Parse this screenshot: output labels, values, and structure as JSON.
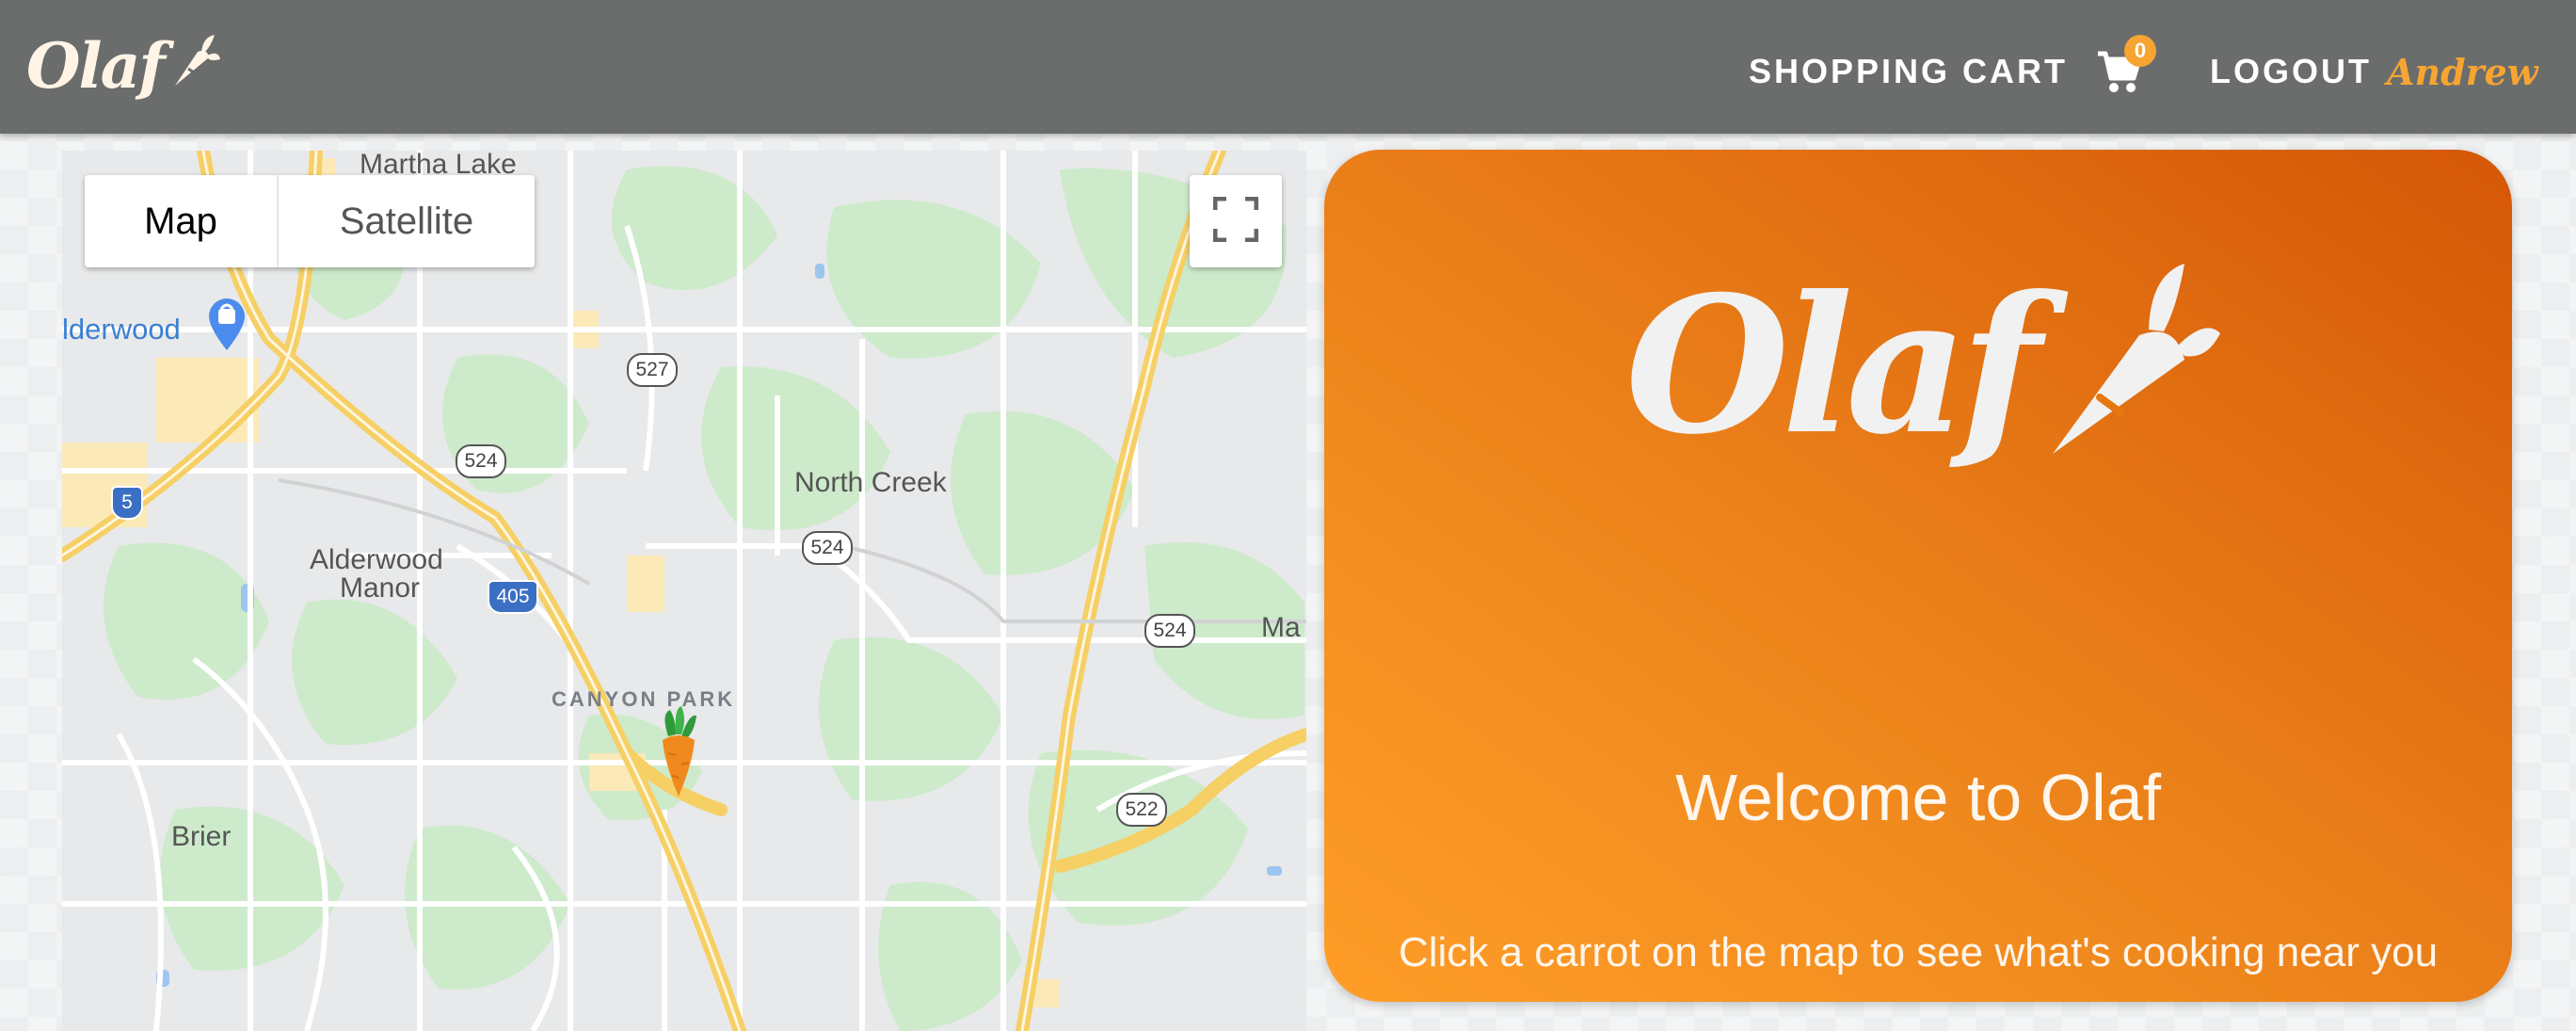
{
  "navbar": {
    "brand": "Olaf",
    "cart_label": "SHOPPING CART",
    "cart_count": "0",
    "logout_label": "LOGOUT",
    "user_name": "Andrew"
  },
  "map": {
    "type_buttons": {
      "map": "Map",
      "satellite": "Satellite"
    },
    "labels": {
      "martha_lake": "Martha Lake",
      "alderwood": "lderwood",
      "north_creek": "North Creek",
      "alderwood_manor_1": "Alderwood",
      "alderwood_manor_2": "Manor",
      "canyon_park": "CANYON PARK",
      "brier": "Brier",
      "ma": "Ma"
    },
    "route_shields": {
      "r527": "527",
      "r524a": "524",
      "r524b": "524",
      "r524c": "524",
      "r522": "522",
      "i5": "5",
      "i405": "405"
    }
  },
  "welcome": {
    "logo": "Olaf",
    "title": "Welcome to Olaf",
    "subtitle": "Click a carrot on the map to see what's cooking near you"
  },
  "colors": {
    "navbar_bg": "#6b6c6c",
    "accent": "#f6a531",
    "card_gradient_start": "#ff9d28",
    "card_gradient_end": "#d45706"
  },
  "icons": [
    "carrot-icon",
    "shopping-cart-icon",
    "fullscreen-icon",
    "shopping-pin-icon",
    "carrot-marker-icon"
  ]
}
